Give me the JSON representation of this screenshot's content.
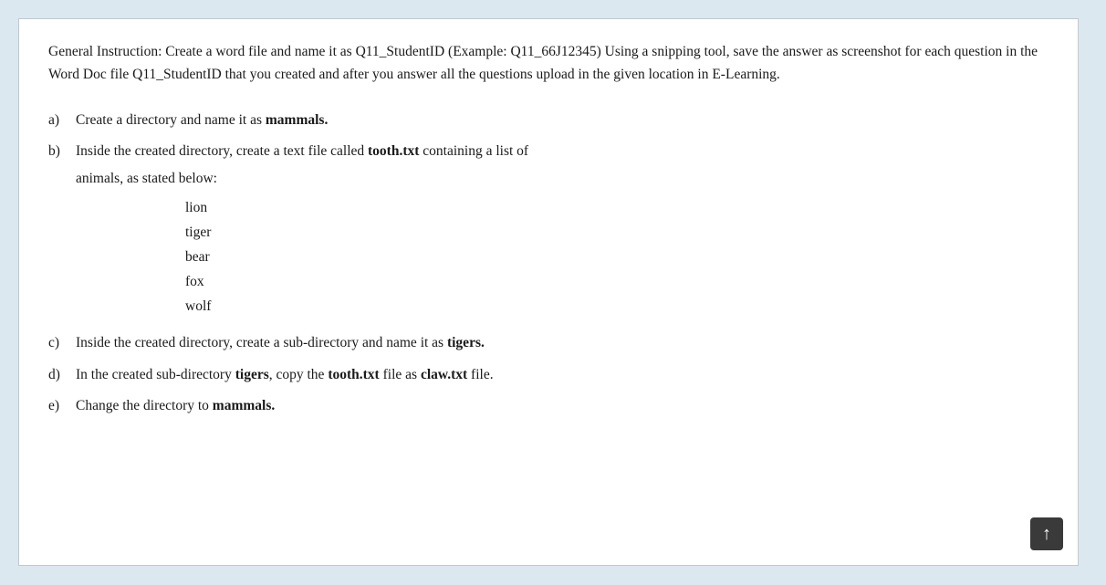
{
  "page": {
    "background_color": "#dce8f0",
    "content_background": "#ffffff"
  },
  "general_instruction": {
    "text": "General Instruction: Create a word file and name it as Q11_StudentID (Example: Q11_66J12345) Using a snipping tool, save the answer as screenshot for each question in the Word Doc file Q11_StudentID that you created and after you answer all the questions upload in the given location in E-Learning."
  },
  "questions": [
    {
      "label": "a)",
      "text_before": "Create a directory and name it as ",
      "bold_text": "mammals.",
      "text_after": ""
    },
    {
      "label": "b)",
      "text_before": "Inside the created directory, create a text file called ",
      "bold_text": "tooth.txt",
      "text_after": " containing a list of"
    },
    {
      "label": "",
      "indent_text": "animals, as stated below:"
    },
    {
      "label": "c)",
      "text_before": "Inside the created directory, create a sub-directory and name it as ",
      "bold_text": "tigers.",
      "text_after": ""
    },
    {
      "label": "d)",
      "text_before": "In the created sub-directory ",
      "bold_text1": "tigers",
      "text_middle": ", copy the ",
      "bold_text2": "tooth.txt",
      "text_middle2": " file as ",
      "bold_text3": "claw.txt",
      "text_after": " file."
    },
    {
      "label": "e)",
      "text_before": "Change the directory to ",
      "bold_text": "mammals.",
      "text_after": ""
    }
  ],
  "animals": [
    "lion",
    "tiger",
    "bear",
    "fox",
    "wolf"
  ],
  "scroll_up_button": {
    "symbol": "↑",
    "label": "scroll-up"
  }
}
